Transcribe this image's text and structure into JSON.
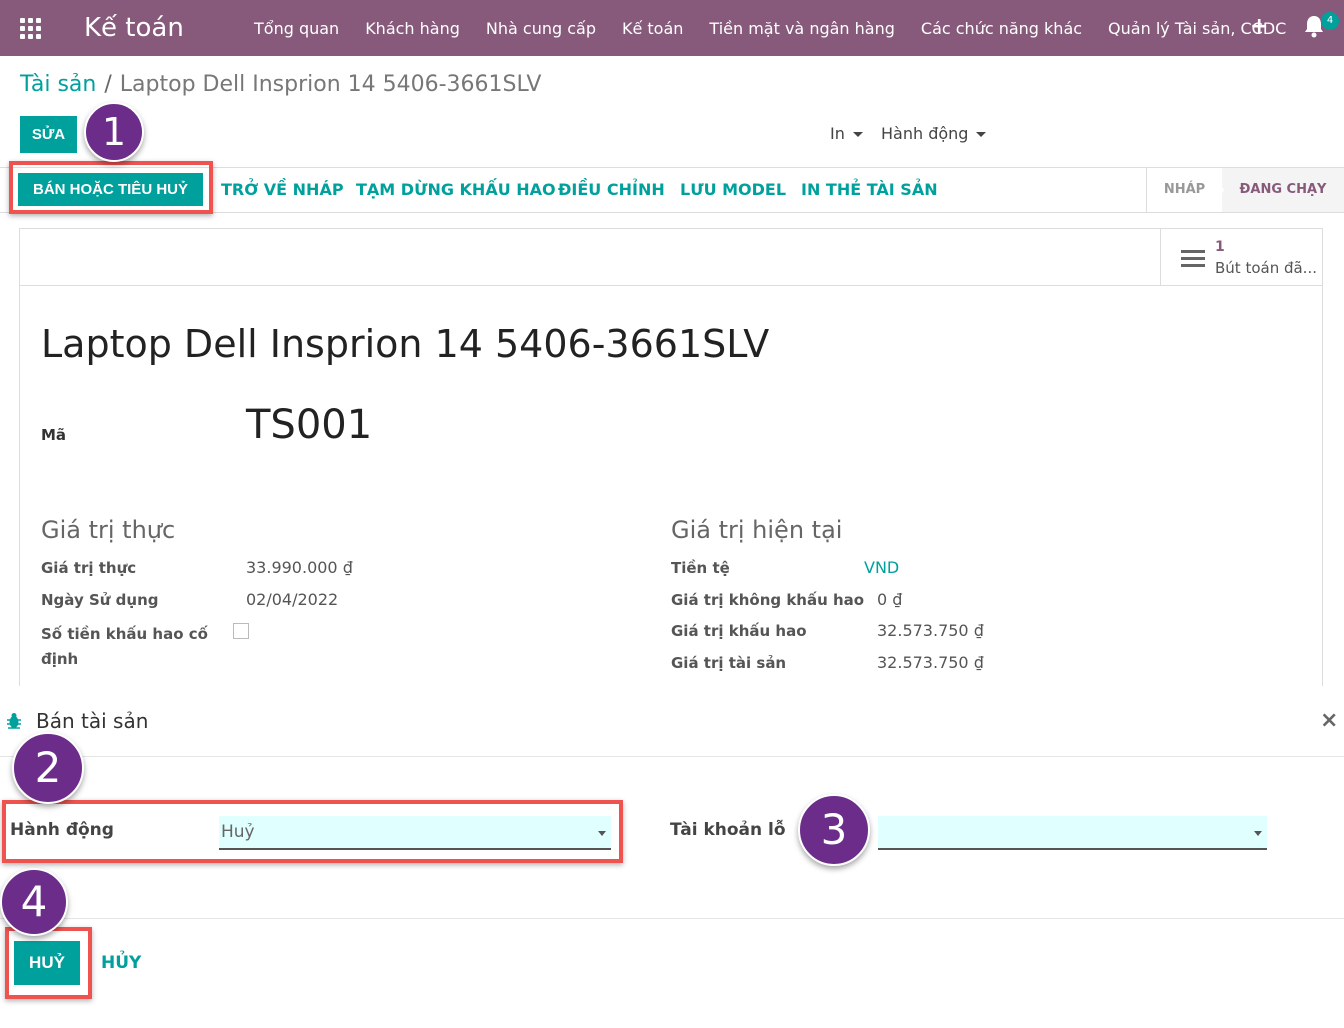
{
  "app": {
    "title": "Kế toán"
  },
  "nav": {
    "menu": [
      "Tổng quan",
      "Khách hàng",
      "Nhà cung cấp",
      "Kế toán",
      "Tiền mặt và ngân hàng",
      "Các chức năng khác",
      "Quản lý Tài sản, CCDC"
    ],
    "plus_icon": "+",
    "badge_count": "4"
  },
  "breadcrumb": {
    "parent": "Tài sản",
    "separator": "/",
    "current": "Laptop Dell Insprion 14 5406-3661SLV"
  },
  "controls": {
    "edit_label": "SỬA",
    "print_label": "In",
    "action_label": "Hành động"
  },
  "statusbar": {
    "buttons": [
      "BÁN HOẶC TIÊU HUỶ",
      "TRỞ VỀ NHÁP",
      "TẠM DỪNG KHẤU HAO",
      "ĐIỀU CHỈNH",
      "LƯU MODEL",
      "IN THẺ TÀI SẢN"
    ],
    "stages": [
      "NHÁP",
      "ĐANG CHẠY"
    ],
    "active_stage": "ĐANG CHẠY"
  },
  "smart_button": {
    "count": "1",
    "label": "Bút toán đã..."
  },
  "form": {
    "title": "Laptop Dell Insprion 14 5406-3661SLV",
    "code_label": "Mã",
    "code_value": "TS001",
    "left_section": {
      "title": "Giá trị thực",
      "fields": [
        {
          "label": "Giá trị thực",
          "value": "33.990.000 ₫"
        },
        {
          "label": "Ngày Sử dụng",
          "value": "02/04/2022"
        },
        {
          "label": "Số tiền khấu hao cố định",
          "value": ""
        }
      ]
    },
    "right_section": {
      "title": "Giá trị hiện tại",
      "fields": [
        {
          "label": "Tiền tệ",
          "value": "VND"
        },
        {
          "label": "Giá trị không khấu hao",
          "value": "0 ₫"
        },
        {
          "label": "Giá trị khấu hao",
          "value": "32.573.750 ₫"
        },
        {
          "label": "Giá trị tài sản",
          "value": "32.573.750 ₫"
        }
      ]
    }
  },
  "dialog": {
    "title": "Bán tài sản",
    "close_icon": "×",
    "action_label": "Hành động",
    "action_value": "Huỷ",
    "loss_account_label": "Tài khoản lỗ",
    "loss_account_value": "",
    "confirm_label": "HUỶ",
    "cancel_label": "HỦY"
  },
  "annotations": [
    "1",
    "2",
    "3",
    "4"
  ],
  "colors": {
    "navbar": "#875a7b",
    "primary": "#00a09d",
    "highlight_box": "#ef5350",
    "marker": "#6b2c8a",
    "field_bg": "#e0ffff"
  }
}
